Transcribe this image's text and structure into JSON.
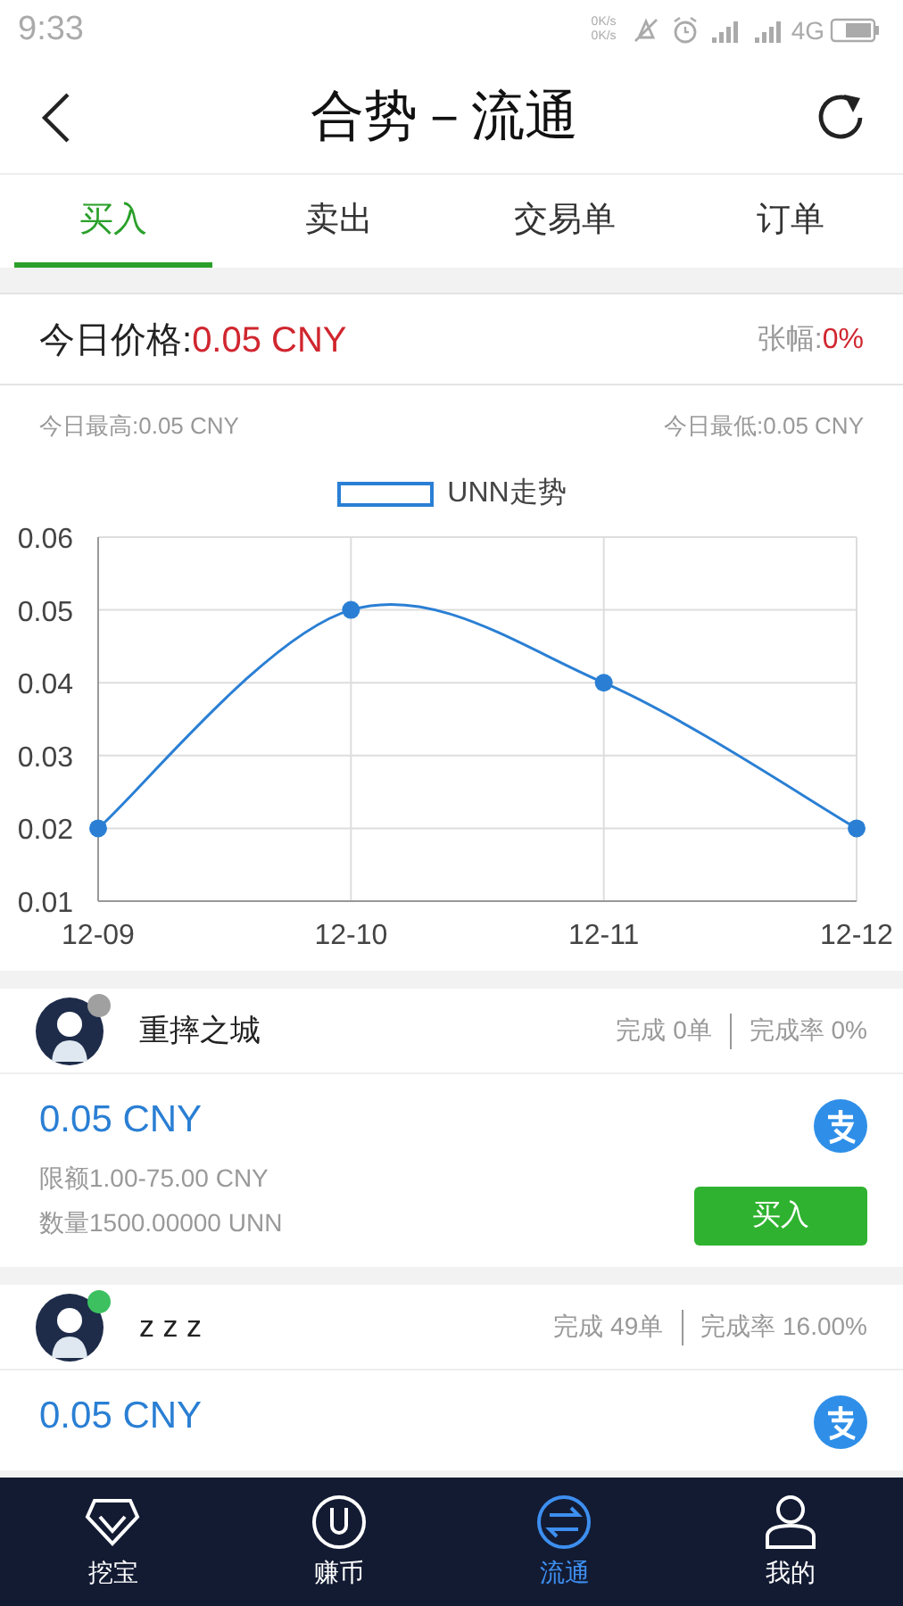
{
  "status_bar": {
    "time": "9:33",
    "speed_up": "0K/s",
    "speed_down": "0K/s",
    "network": "4G"
  },
  "header": {
    "title": "合势－流通"
  },
  "tabs": [
    {
      "label": "买入",
      "selected": true
    },
    {
      "label": "卖出",
      "selected": false
    },
    {
      "label": "交易单",
      "selected": false
    },
    {
      "label": "订单",
      "selected": false
    }
  ],
  "price_panel": {
    "label": "今日价格:",
    "price": "0.05 CNY",
    "change_label": "张幅:",
    "change": "0%",
    "high": "今日最高:0.05 CNY",
    "low": "今日最低:0.05 CNY"
  },
  "chart": {
    "chart_data": {
      "type": "line",
      "grid": true,
      "categories": [
        "12-09",
        "12-10",
        "12-11",
        "12-12"
      ],
      "series": [
        {
          "name": "UNN走势",
          "color": "#2a7fd4",
          "marker": "circle",
          "values": [
            0.02,
            0.05,
            0.04,
            0.02
          ]
        }
      ],
      "ylim": [
        0.01,
        0.06
      ],
      "yticks": [
        {
          "value": 0.01,
          "label": "0.01"
        },
        {
          "value": 0.02,
          "label": "0.02"
        },
        {
          "value": 0.03,
          "label": "0.03"
        },
        {
          "value": 0.04,
          "label": "0.04"
        },
        {
          "value": 0.05,
          "label": "0.05"
        },
        {
          "value": 0.06,
          "label": "0.06"
        }
      ]
    }
  },
  "merchants": [
    {
      "name": "重摔之城",
      "color": "#a0a0a0",
      "completed": "完成 0单",
      "rate": "完成率 0%",
      "price": "0.05 CNY",
      "limit": "限额1.00-75.00 CNY",
      "amount": "数量1500.00000 UNN",
      "button": "买入"
    },
    {
      "name": "z z z",
      "color": "#3cc060",
      "completed": "完成 49单",
      "rate": "完成率 16.00%",
      "price": "0.05 CNY"
    }
  ],
  "bottom_nav": [
    {
      "label": "挖宝",
      "kind": "gem",
      "selected": false
    },
    {
      "label": "赚币",
      "kind": "coin",
      "selected": false
    },
    {
      "label": "流通",
      "kind": "exchange",
      "selected": true
    },
    {
      "label": "我的",
      "kind": "person",
      "selected": false
    }
  ]
}
